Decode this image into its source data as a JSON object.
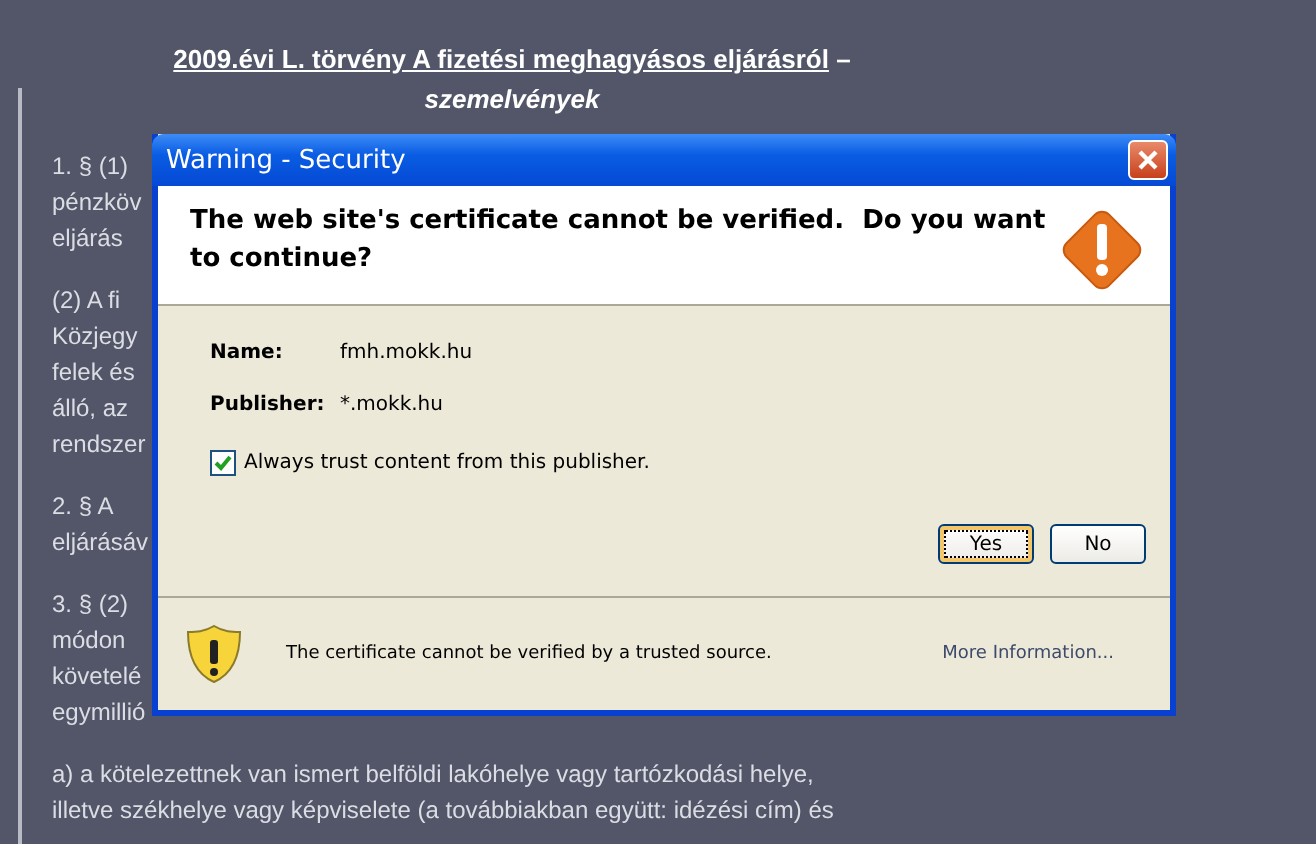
{
  "document": {
    "title": "2009.évi L. törvény A fizetési meghagyásos eljárásról",
    "title_dash": "–",
    "subtitle": "szemelvények",
    "paragraphs": [
      {
        "lines": [
          "1. § (1)",
          "pénzköv",
          "eljárás"
        ]
      },
      {
        "lines": [
          "(2) A fi",
          "Közjegy",
          "felek és",
          "álló, az",
          "rendszer"
        ]
      },
      {
        "lines": [
          "2. § A",
          "eljárásáv"
        ]
      },
      {
        "lines": [
          "3. § (2)",
          "módon",
          "követelé",
          "egymillió"
        ]
      },
      {
        "lines": [
          "a) a kötelezettnek van ismert belföldi lakóhelye vagy tartózkodási helye,",
          "illetve székhelye vagy képviselete (a továbbiakban együtt: idézési cím) és"
        ]
      }
    ]
  },
  "dialog": {
    "title": "Warning - Security",
    "heading": "The web site's certificate cannot be verified.  Do you want to continue?",
    "fields": [
      {
        "label": "Name:",
        "value": "fmh.mokk.hu"
      },
      {
        "label": "Publisher:",
        "value": "*.mokk.hu"
      }
    ],
    "checkbox": {
      "label": "Always trust content from this publisher.",
      "checked": true
    },
    "buttons": [
      {
        "label": "Yes",
        "focused": true
      },
      {
        "label": "No",
        "focused": false
      }
    ],
    "footer": {
      "message": "The certificate cannot be verified by a trusted source.",
      "link": "More Information..."
    }
  }
}
